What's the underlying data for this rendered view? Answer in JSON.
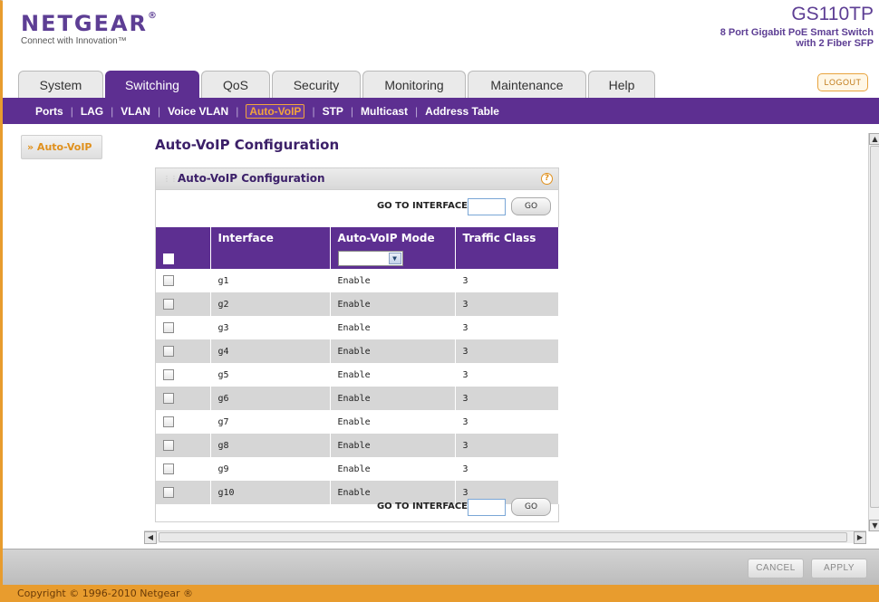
{
  "brand": {
    "logo": "NETGEAR",
    "logo_mark": "®",
    "tagline": "Connect with Innovation™",
    "model": "GS110TP",
    "model_desc_1": "8 Port Gigabit PoE Smart Switch",
    "model_desc_2": "with 2 Fiber SFP",
    "accent_color": "#5d2f91",
    "highlight_color": "#e89c2e"
  },
  "tabs": [
    {
      "label": "System",
      "active": false
    },
    {
      "label": "Switching",
      "active": true
    },
    {
      "label": "QoS",
      "active": false
    },
    {
      "label": "Security",
      "active": false
    },
    {
      "label": "Monitoring",
      "active": false
    },
    {
      "label": "Maintenance",
      "active": false
    },
    {
      "label": "Help",
      "active": false
    }
  ],
  "logout_label": "LOGOUT",
  "subnav": [
    {
      "label": "Ports",
      "active": false
    },
    {
      "label": "LAG",
      "active": false
    },
    {
      "label": "VLAN",
      "active": false
    },
    {
      "label": "Voice VLAN",
      "active": false
    },
    {
      "label": "Auto-VoIP",
      "active": true
    },
    {
      "label": "STP",
      "active": false
    },
    {
      "label": "Multicast",
      "active": false
    },
    {
      "label": "Address Table",
      "active": false
    }
  ],
  "leftnav": {
    "item": "» Auto-VoIP"
  },
  "page": {
    "title": "Auto-VoIP Configuration",
    "panel_title": "Auto-VoIP Configuration",
    "help_icon": "?",
    "goto_label": "GO TO INTERFACE",
    "goto_value": "",
    "go_button": "GO"
  },
  "table": {
    "headers": [
      "",
      "Interface",
      "Auto-VoIP Mode",
      "Traffic Class"
    ],
    "filter_mode_value": "",
    "rows": [
      {
        "interface": "g1",
        "mode": "Enable",
        "traffic_class": "3"
      },
      {
        "interface": "g2",
        "mode": "Enable",
        "traffic_class": "3"
      },
      {
        "interface": "g3",
        "mode": "Enable",
        "traffic_class": "3"
      },
      {
        "interface": "g4",
        "mode": "Enable",
        "traffic_class": "3"
      },
      {
        "interface": "g5",
        "mode": "Enable",
        "traffic_class": "3"
      },
      {
        "interface": "g6",
        "mode": "Enable",
        "traffic_class": "3"
      },
      {
        "interface": "g7",
        "mode": "Enable",
        "traffic_class": "3"
      },
      {
        "interface": "g8",
        "mode": "Enable",
        "traffic_class": "3"
      },
      {
        "interface": "g9",
        "mode": "Enable",
        "traffic_class": "3"
      },
      {
        "interface": "g10",
        "mode": "Enable",
        "traffic_class": "3"
      }
    ]
  },
  "footer": {
    "cancel": "CANCEL",
    "apply": "APPLY",
    "copyright": "Copyright © 1996-2010 Netgear ®"
  }
}
